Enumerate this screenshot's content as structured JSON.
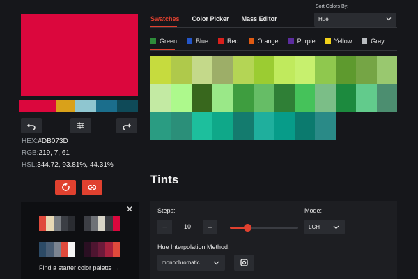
{
  "preview": {
    "color": "#DB073D"
  },
  "palette_strip": [
    {
      "color": "#DB073D",
      "flex": 52
    },
    {
      "color": "#D9A11A",
      "flex": 27
    },
    {
      "color": "#8FC6D0",
      "flex": 30
    },
    {
      "color": "#1B6E8C",
      "flex": 30
    },
    {
      "color": "#0F4A58",
      "flex": 29
    }
  ],
  "color_info": {
    "hex_label": "HEX:",
    "hex_value": "#DB073D",
    "rgb_label": "RGB:",
    "rgb_value": "219, 7, 61",
    "hsl_label": "HSL:",
    "hsl_value": "344.72, 93.81%, 44.31%"
  },
  "starter": {
    "close": "✕",
    "link": "Find a starter color palette →",
    "palettes": [
      [
        "#E04A3C",
        "#E8D9B5",
        "#7A7E83",
        "#3B3E44",
        "#2A2C31"
      ],
      [
        "#3D3F45",
        "#6E7176",
        "#D8D5C8",
        "#3A3C42",
        "#DB073D"
      ],
      [
        "#2C4A66",
        "#495D74",
        "#7B8491",
        "#E04A3C",
        "#F4F4F4"
      ],
      [
        "#2A0F22",
        "#4E1530",
        "#6C1A3A",
        "#A7213E",
        "#E04A3C"
      ]
    ]
  },
  "tabs": [
    "Swatches",
    "Color Picker",
    "Mass Editor"
  ],
  "sort": {
    "label": "Sort Colors By:",
    "value": "Hue"
  },
  "categories": [
    {
      "name": "Green",
      "color": "#2E8B3A"
    },
    {
      "name": "Blue",
      "color": "#2456C9"
    },
    {
      "name": "Red",
      "color": "#D9201C"
    },
    {
      "name": "Orange",
      "color": "#E05A12"
    },
    {
      "name": "Purple",
      "color": "#5B2C9E"
    },
    {
      "name": "Yellow",
      "color": "#F2D21B"
    },
    {
      "name": "Gray",
      "color": "#B9BCC0"
    }
  ],
  "swatch_rows": [
    [
      "#C6DB3E",
      "#AFC94B",
      "#C4D98A",
      "#9DAE68",
      "#B4D555",
      "#9BCC32",
      "#C0EA5D",
      "#C7F06E",
      "#8FC84E",
      "#5E9A2E",
      "#75A545",
      "#99C86F"
    ],
    [
      "#C3EAA3",
      "#ADF98C",
      "#38671D",
      "#9AE888",
      "#3E9D3F",
      "#66BD66",
      "#2F7F36",
      "#45C25A",
      "#7BBE87",
      "#1C8A3E",
      "#62CB8C",
      "#4C8E70"
    ],
    [
      "#2A9C82",
      "#2B8F79",
      "#1DBF9D",
      "#0FA889",
      "#147B6E",
      "#1FAF9D",
      "#079C89",
      "#0B7A6E",
      "#2A8A87"
    ]
  ],
  "tints": {
    "title": "Tints",
    "steps_label": "Steps:",
    "steps_value": "10",
    "minus": "−",
    "plus": "+",
    "slider_level": 0.26,
    "mode_label": "Mode:",
    "mode_value": "LCH",
    "interp_label": "Hue Interpolation Method:",
    "interp_value": "monochromatic"
  }
}
